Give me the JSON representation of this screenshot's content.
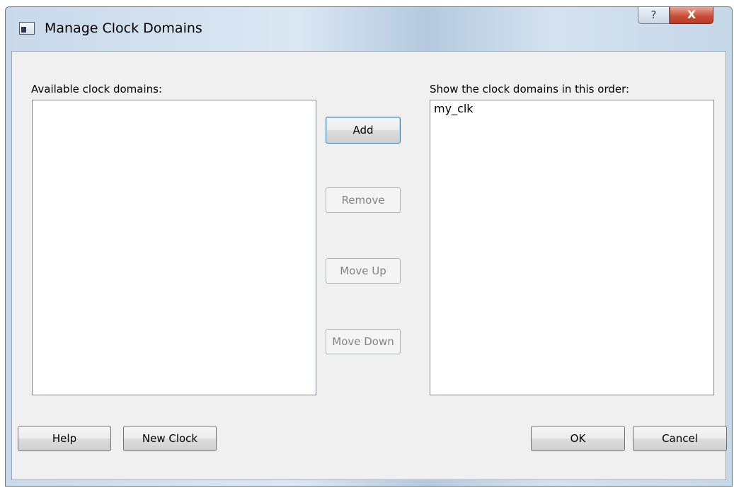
{
  "window": {
    "title": "Manage Clock Domains",
    "help_glyph": "?",
    "close_glyph": "X"
  },
  "available": {
    "label": "Available clock domains:",
    "items": []
  },
  "ordered": {
    "label": "Show the clock domains in this order:",
    "items": [
      "my_clk"
    ]
  },
  "actions": {
    "add": "Add",
    "remove": "Remove",
    "move_up": "Move Up",
    "move_down": "Move Down"
  },
  "footer": {
    "help": "Help",
    "new_clock": "New Clock",
    "ok": "OK",
    "cancel": "Cancel"
  },
  "colors": {
    "accent_border": "#3c7fb1",
    "close_red": "#c94f3a"
  },
  "icons": {
    "window": "window-icon",
    "help": "help-icon",
    "close": "close-icon"
  }
}
